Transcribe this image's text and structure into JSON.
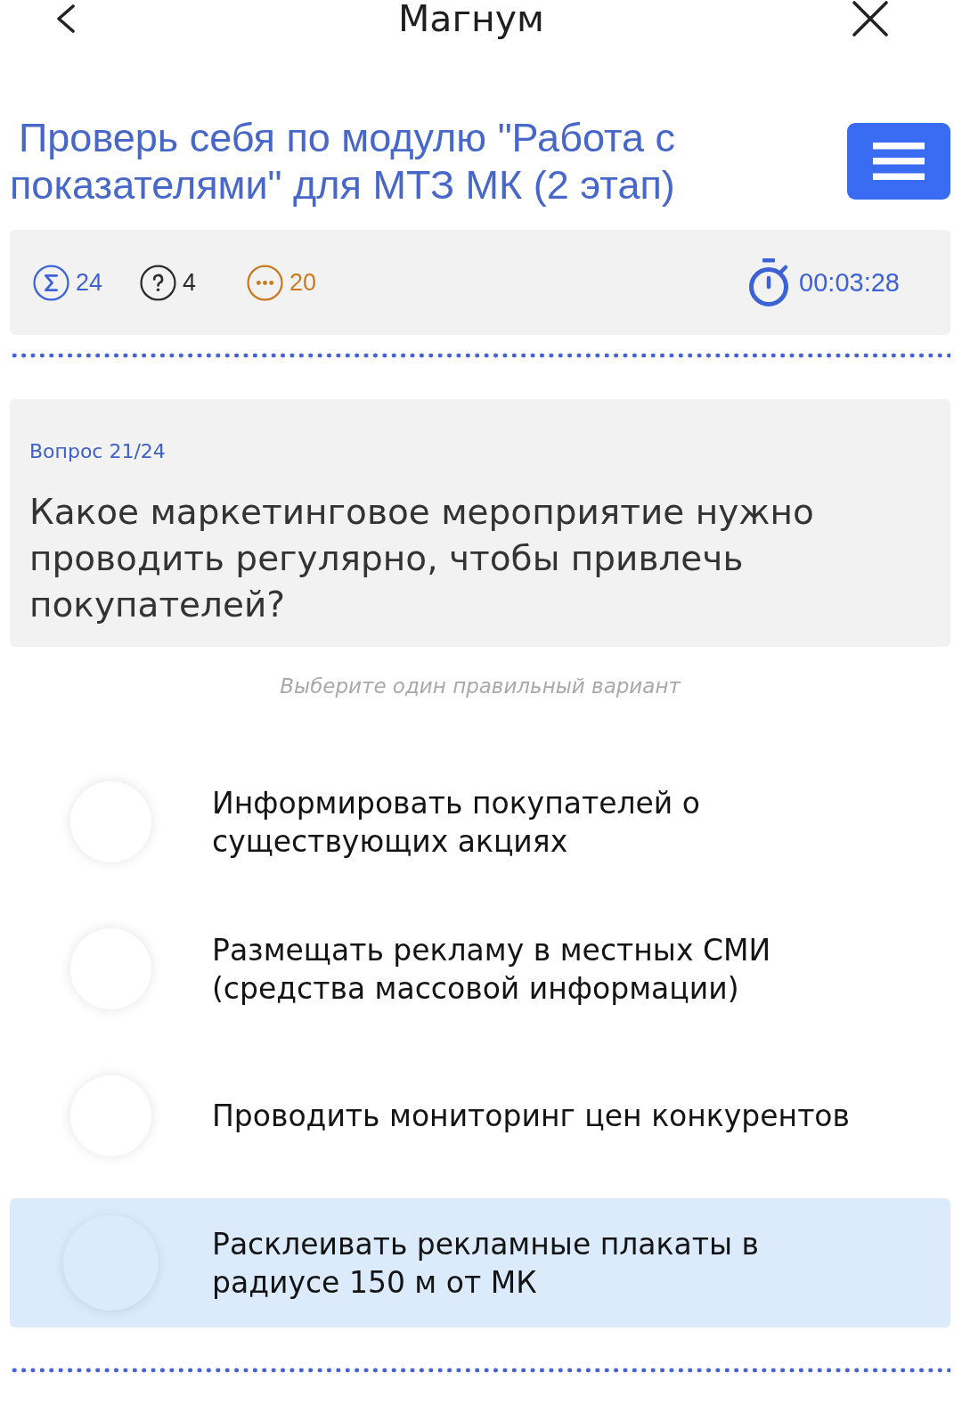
{
  "header": {
    "title": "Магнум"
  },
  "quiz": {
    "title": "Проверь себя по модулю \"Работа с показателями\" для МТЗ МК (2 этап)"
  },
  "stats": [
    {
      "kind": "sigma",
      "value": "24",
      "color": "#3f63d6"
    },
    {
      "kind": "question",
      "value": "4",
      "color": "#2b2b2b"
    },
    {
      "kind": "ellipsis",
      "value": "20",
      "color": "#c77a1e"
    }
  ],
  "timer": {
    "value": "00:03:28"
  },
  "question": {
    "counter": "Вопрос 21/24",
    "text": "Какое маркетинговое мероприятие нужно проводить регулярно, чтобы привлечь покупателей?",
    "hint": "Выберите один правильный вариант"
  },
  "options": [
    {
      "text": "Информировать покупателей о существующих акциях",
      "selected": false
    },
    {
      "text": "Размещать рекламу в местных СМИ (средства массовой информации)",
      "selected": false
    },
    {
      "text": "Проводить мониторинг цен конкурентов",
      "selected": false
    },
    {
      "text": "Расклеивать рекламные плакаты в радиусе 150 м от МК",
      "selected": true
    }
  ]
}
